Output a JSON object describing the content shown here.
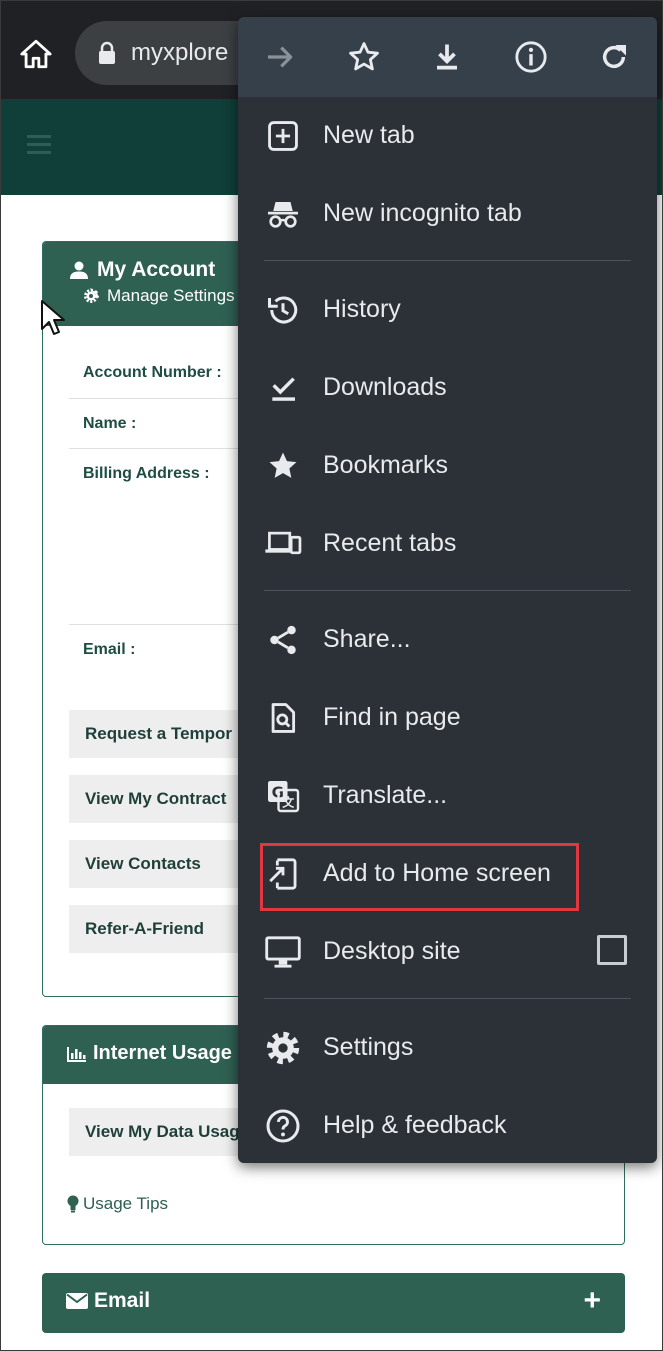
{
  "browser": {
    "url_text": "myxplore"
  },
  "account_card": {
    "title": "My Account",
    "subtitle": "Manage Settings",
    "fields": [
      {
        "label": "Account Number :"
      },
      {
        "label": "Name :"
      },
      {
        "label": "Billing Address :"
      },
      {
        "label": "Email :"
      }
    ],
    "actions": [
      {
        "label": "Request a Tempor"
      },
      {
        "label": "View My Contract"
      },
      {
        "label": "View Contacts"
      },
      {
        "label": "Refer-A-Friend"
      }
    ]
  },
  "usage_card": {
    "title": "Internet Usage",
    "action": "View My Data Usag",
    "tips": "Usage Tips"
  },
  "email_bar": {
    "title": "Email",
    "expand": "+"
  },
  "menu": {
    "toolbar": [
      "forward-icon",
      "star-icon",
      "download-icon",
      "info-icon",
      "refresh-icon"
    ],
    "items": [
      {
        "label": "New tab",
        "icon": "new-tab-icon"
      },
      {
        "label": "New incognito tab",
        "icon": "incognito-icon"
      },
      {
        "label": "History",
        "icon": "history-icon"
      },
      {
        "label": "Downloads",
        "icon": "downloads-icon"
      },
      {
        "label": "Bookmarks",
        "icon": "bookmarks-star-icon"
      },
      {
        "label": "Recent tabs",
        "icon": "devices-icon"
      },
      {
        "label": "Share...",
        "icon": "share-icon"
      },
      {
        "label": "Find in page",
        "icon": "find-in-page-icon"
      },
      {
        "label": "Translate...",
        "icon": "translate-icon"
      },
      {
        "label": "Add to Home screen",
        "icon": "add-to-home-icon",
        "highlighted": true
      },
      {
        "label": "Desktop site",
        "icon": "monitor-icon",
        "checked": false
      },
      {
        "label": "Settings",
        "icon": "gear-icon"
      },
      {
        "label": "Help & feedback",
        "icon": "help-icon"
      }
    ]
  },
  "colors": {
    "menu_bg": "#2b3136",
    "menu_toolbar_bg": "#35404b",
    "brand_green": "#2f6152",
    "header_green": "#0f3f38",
    "highlight_red": "#e0383e"
  }
}
